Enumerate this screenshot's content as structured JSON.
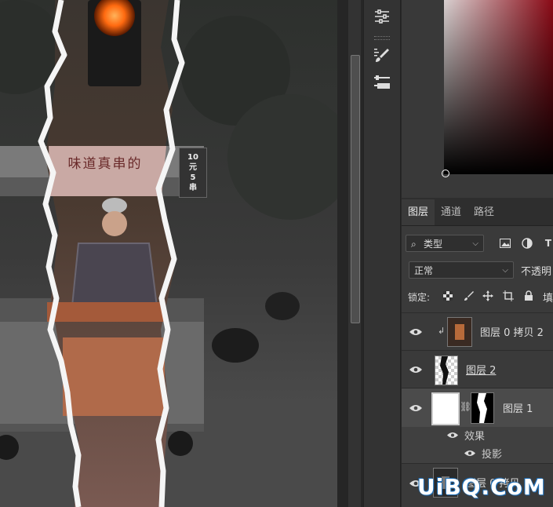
{
  "canvas": {
    "sign_text": "味道真串的",
    "price_sign": [
      "10",
      "元",
      "5",
      "串"
    ]
  },
  "tools": {
    "items": [
      {
        "icon": "adjustments-sliders-icon"
      },
      {
        "icon": "brush-settings-icon"
      },
      {
        "icon": "tool-presets-icon"
      }
    ]
  },
  "layers_panel": {
    "tabs": [
      "图层",
      "通道",
      "路径"
    ],
    "active_tab": "图层",
    "filter": {
      "label": "类型"
    },
    "blend_mode": "正常",
    "opacity_label": "不透明",
    "lock_label": "锁定:",
    "fill_label": "填",
    "layers": [
      {
        "name": "图层 0 拷贝 2",
        "visible": true,
        "clipped": true
      },
      {
        "name": "图层 2",
        "visible": true
      },
      {
        "name": "图层 1",
        "visible": true,
        "selected": true,
        "has_mask": true,
        "effects_label": "效果",
        "effects": [
          "投影"
        ]
      },
      {
        "name": "图层 0 拷贝",
        "visible": true
      }
    ]
  },
  "watermark": "UiBQ.CoM",
  "colors": {
    "panel_bg": "#3a3a3a",
    "selected_row": "#4b4b4b",
    "picker_red": "#8a0a16",
    "traffic_light": "#ff7a1a"
  }
}
